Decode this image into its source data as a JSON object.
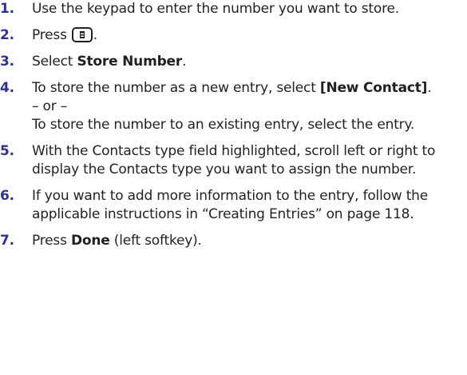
{
  "steps": [
    {
      "num": "1.",
      "text": "Use the keypad to enter the number you want to store."
    },
    {
      "num": "2.",
      "pre": "Press",
      "icon": "menu-key-icon",
      "post": "."
    },
    {
      "num": "3.",
      "pre": "Select ",
      "bold": "Store Number",
      "post": "."
    },
    {
      "num": "4.",
      "pre": "To store the number as a new entry, select ",
      "bold": "[New Contact]",
      "post": ".",
      "or": "– or –",
      "alt": "To store the number to an existing entry, select the entry."
    },
    {
      "num": "5.",
      "text": "With the Contacts type field highlighted, scroll left or right to display the Contacts type you want to assign the number."
    },
    {
      "num": "6.",
      "text": "If you want to add more information to the entry, follow the applicable instructions in “Creating Entries” on page 118."
    },
    {
      "num": "7.",
      "pre": "Press ",
      "bold": "Done",
      "post": " (left softkey)."
    }
  ],
  "colors": {
    "step_number": "#2e3192",
    "text": "#231f20"
  }
}
